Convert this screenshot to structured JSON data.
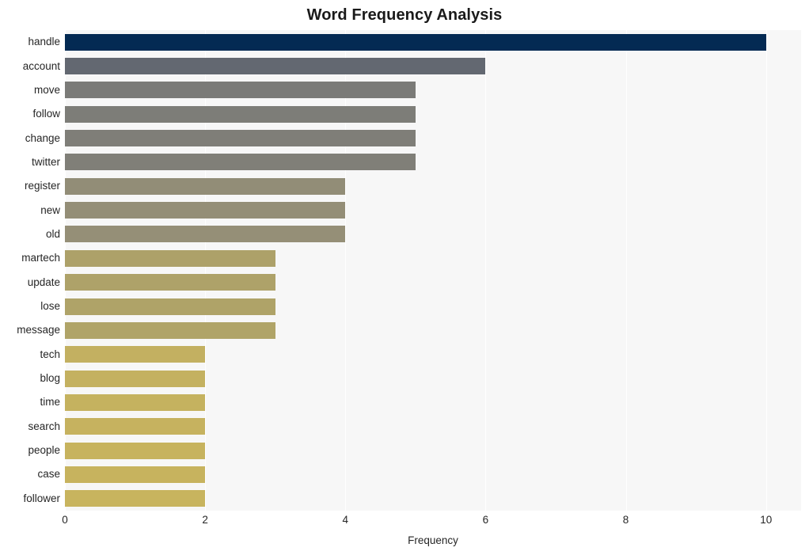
{
  "chart_data": {
    "type": "bar",
    "orientation": "horizontal",
    "title": "Word Frequency Analysis",
    "xlabel": "Frequency",
    "ylabel": "",
    "xlim": [
      0,
      10.5
    ],
    "xticks": [
      0,
      2,
      4,
      6,
      8,
      10
    ],
    "xticklabels": [
      "0",
      "2",
      "4",
      "6",
      "8",
      "10"
    ],
    "grid": true,
    "grid_axis": "x",
    "legend": false,
    "categories": [
      "handle",
      "account",
      "move",
      "follow",
      "change",
      "twitter",
      "register",
      "new",
      "old",
      "martech",
      "update",
      "lose",
      "message",
      "tech",
      "blog",
      "time",
      "search",
      "people",
      "case",
      "follower"
    ],
    "values": [
      10,
      6,
      5,
      5,
      5,
      5,
      4,
      4,
      4,
      3,
      3,
      3,
      3,
      2,
      2,
      2,
      2,
      2,
      2,
      2
    ],
    "bar_colors": [
      "#042a53",
      "#636871",
      "#7b7b78",
      "#7d7d78",
      "#7f7e78",
      "#807f78",
      "#928d77",
      "#948e77",
      "#958f77",
      "#ada169",
      "#aea269",
      "#afa368",
      "#b0a468",
      "#c3b061",
      "#c4b160",
      "#c5b25f",
      "#c6b25f",
      "#c7b35e",
      "#c7b35e",
      "#c8b45e"
    ],
    "plot_background": "#f7f7f7",
    "gridline_color": "#ffffff",
    "figure_background": "#ffffff"
  }
}
